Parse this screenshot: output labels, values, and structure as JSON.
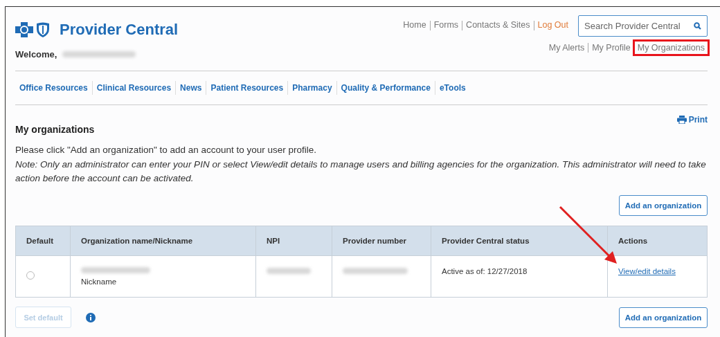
{
  "header": {
    "title": "Provider Central",
    "welcome": "Welcome,",
    "top_links": [
      {
        "label": "Home",
        "kind": "plain"
      },
      {
        "label": "Forms",
        "kind": "plain"
      },
      {
        "label": "Contacts & Sites",
        "kind": "plain"
      },
      {
        "label": "Log Out",
        "kind": "logout"
      }
    ],
    "search": {
      "placeholder": "Search Provider Central"
    },
    "account_links": [
      {
        "label": "My Alerts",
        "highlighted": false
      },
      {
        "label": "My Profile",
        "highlighted": false
      },
      {
        "label": "My Organizations",
        "highlighted": true
      }
    ]
  },
  "nav": {
    "items": [
      "Office Resources",
      "Clinical Resources",
      "News",
      "Patient Resources",
      "Pharmacy",
      "Quality & Performance",
      "eTools"
    ]
  },
  "main": {
    "heading": "My organizations",
    "print": "Print",
    "intro": "Please click \"Add an organization\" to add an account to your user profile.",
    "note": "Note: Only an administrator can enter your PIN or select View/edit details to manage users and billing agencies for the organization. This administrator will need to take action before the account can be activated.",
    "add_button": "Add an organization",
    "table": {
      "columns": [
        "Default",
        "Organization name/Nickname",
        "NPI",
        "Provider number",
        "Provider Central status",
        "Actions"
      ],
      "rows": [
        {
          "selected": false,
          "nickname": "Nickname",
          "status": "Active as of: 12/27/2018",
          "action": "View/edit details"
        }
      ]
    },
    "set_default": {
      "label": "Set default",
      "disabled": true
    },
    "add_button_bottom": "Add an organization"
  }
}
